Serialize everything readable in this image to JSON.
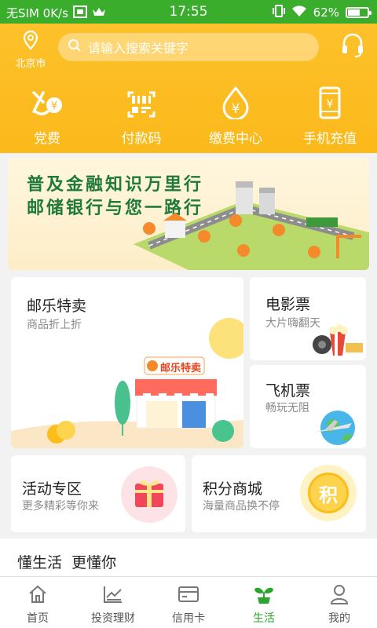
{
  "status_bar": {
    "carrier": "无SIM 0K/s",
    "time": "17:55",
    "battery": "62%",
    "battery_level": 0.62
  },
  "header": {
    "city": "北京市",
    "search_placeholder": "请输入搜索关键字",
    "quick_actions": [
      {
        "label": "党费",
        "icon": "party-fee-icon"
      },
      {
        "label": "付款码",
        "icon": "pay-code-icon"
      },
      {
        "label": "缴费中心",
        "icon": "payment-center-icon"
      },
      {
        "label": "手机充值",
        "icon": "mobile-recharge-icon"
      }
    ]
  },
  "banner": {
    "line1": "普及金融知识万里行",
    "line2": "邮储银行与您一路行"
  },
  "cards": {
    "youle": {
      "title": "邮乐特卖",
      "subtitle": "商品折上折",
      "shop_sign": "邮乐特卖"
    },
    "movie": {
      "title": "电影票",
      "subtitle": "大片嗨翻天"
    },
    "flight": {
      "title": "飞机票",
      "subtitle": "畅玩无阻"
    },
    "activity": {
      "title": "活动专区",
      "subtitle": "更多精彩等你来"
    },
    "points": {
      "title": "积分商城",
      "subtitle": "海量商品换不停",
      "badge": "积"
    }
  },
  "section": {
    "title": "懂生活  更懂你"
  },
  "tabs": [
    {
      "label": "首页",
      "icon": "home-icon"
    },
    {
      "label": "投资理财",
      "icon": "investment-icon"
    },
    {
      "label": "信用卡",
      "icon": "credit-card-icon"
    },
    {
      "label": "生活",
      "icon": "life-sprout-icon",
      "active": true
    },
    {
      "label": "我的",
      "icon": "user-icon"
    }
  ],
  "colors": {
    "status_green": "#3aad2c",
    "header_yellow": "#fdc12b",
    "active_green": "#2aa52e"
  }
}
